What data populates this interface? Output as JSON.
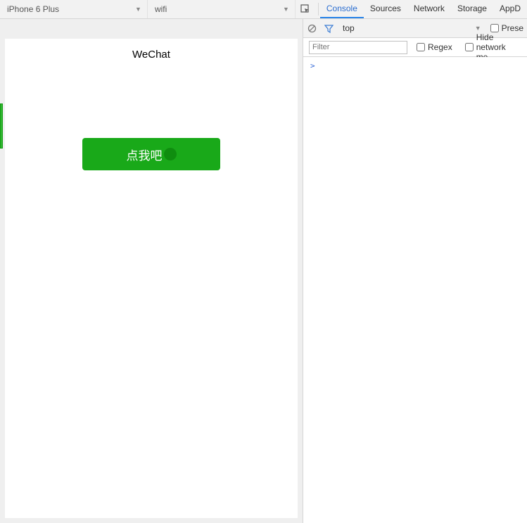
{
  "toolbar": {
    "device": "iPhone 6 Plus",
    "network": "wifi",
    "tabs": [
      "Console",
      "Sources",
      "Network",
      "Storage",
      "AppD"
    ],
    "active_tab": "Console"
  },
  "subbar": {
    "scope": "top",
    "preset": "Prese"
  },
  "filterbar": {
    "filter_placeholder": "Filter",
    "regex_label": "Regex",
    "hide_label": "Hide network me"
  },
  "app": {
    "title": "WeChat",
    "button_label": "点我吧"
  },
  "console": {
    "prompt": ">"
  }
}
